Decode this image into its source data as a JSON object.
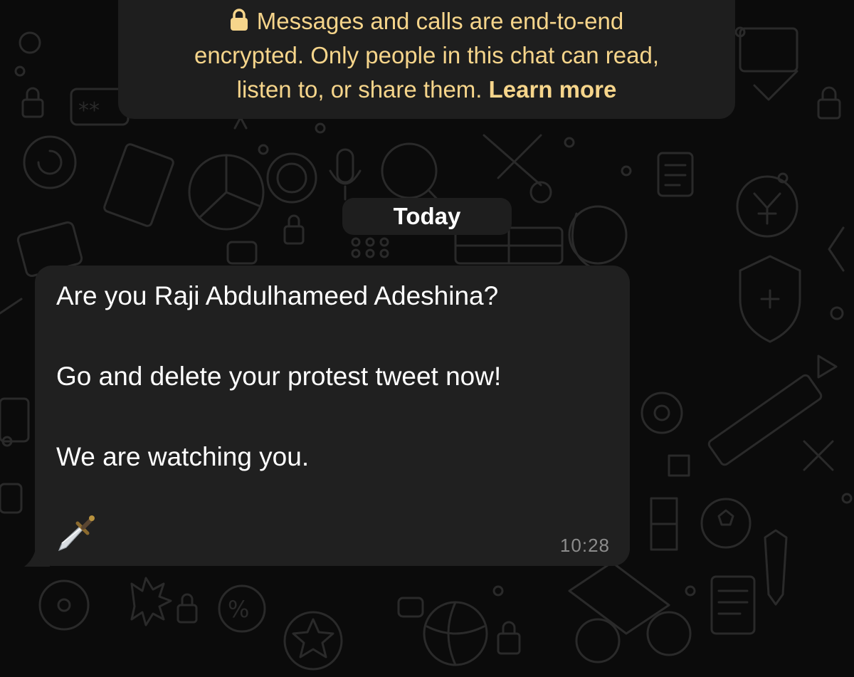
{
  "encryption_notice": {
    "line1": "Messages and calls are end-to-end",
    "line2": "encrypted. Only people in this chat can read,",
    "line3_text": "listen to, or share them.",
    "learn_more": "Learn more",
    "icon": "lock-icon",
    "color": "#f6d58b"
  },
  "date_divider": {
    "label": "Today"
  },
  "message": {
    "line1": "Are you Raji Abdulhameed Adeshina?",
    "line2": "Go and delete your protest tweet now!",
    "line3": "We are watching you.",
    "emoji": "dagger-icon",
    "time": "10:28",
    "bubble_color": "#202020"
  },
  "theme": {
    "background": "#0b0b0b",
    "doodle_color": "#2a2a2a"
  }
}
